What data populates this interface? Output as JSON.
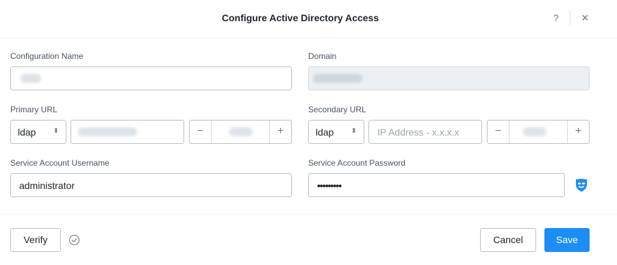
{
  "dialog": {
    "title": "Configure Active Directory Access",
    "help_icon": "?",
    "close_icon": "×"
  },
  "form": {
    "configuration_name": {
      "label": "Configuration Name"
    },
    "domain": {
      "label": "Domain"
    },
    "primary_url": {
      "label": "Primary URL",
      "protocol": "ldap",
      "minus": "−",
      "plus": "+"
    },
    "secondary_url": {
      "label": "Secondary URL",
      "protocol": "ldap",
      "address_placeholder": "IP Address - x.x.x.x",
      "minus": "−",
      "plus": "+"
    },
    "service_account_username": {
      "label": "Service Account Username",
      "value": "administrator"
    },
    "service_account_password": {
      "label": "Service Account Password",
      "value": "•••••••••"
    }
  },
  "footer": {
    "verify_label": "Verify",
    "cancel_label": "Cancel",
    "save_label": "Save"
  },
  "icons": {
    "password_toggle": "eye-mask-icon",
    "verify_status": "check-circle-icon",
    "select_caret": "updown-caret-icon"
  },
  "colors": {
    "primary": "#1b8ff5",
    "border": "#b9c1c9",
    "disabled_bg": "#edf0f2"
  }
}
